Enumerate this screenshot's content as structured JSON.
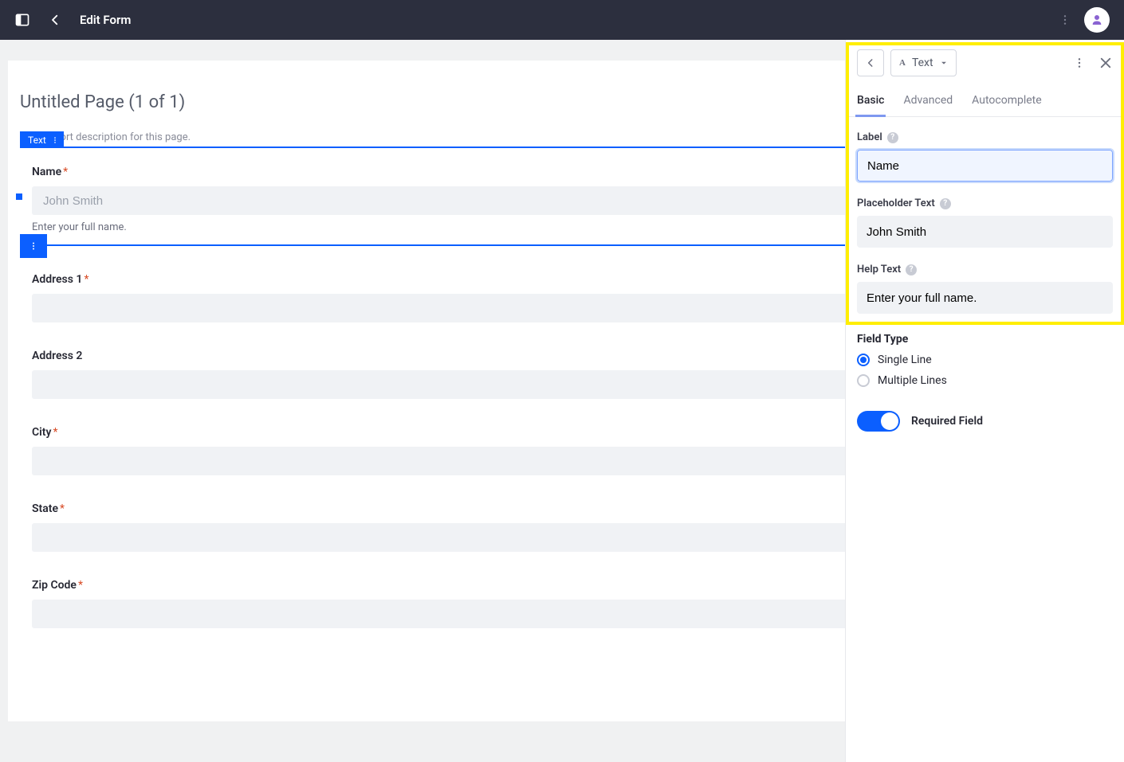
{
  "topbar": {
    "title": "Edit Form"
  },
  "page": {
    "title": "Untitled Page (1 of 1)",
    "desc": "Add a short description for this page."
  },
  "selected_field": {
    "tag": "Text",
    "label": "Name",
    "placeholder": "John Smith",
    "help": "Enter your full name."
  },
  "fields": [
    {
      "label": "Address 1",
      "required": true
    },
    {
      "label": "Address 2",
      "required": false
    },
    {
      "label": "City",
      "required": true
    },
    {
      "label": "State",
      "required": true
    },
    {
      "label": "Zip Code",
      "required": true
    }
  ],
  "panel": {
    "type_dropdown": "Text",
    "tabs": [
      "Basic",
      "Advanced",
      "Autocomplete"
    ],
    "active_tab": 0,
    "label_field": {
      "title": "Label",
      "value": "Name"
    },
    "placeholder_field": {
      "title": "Placeholder Text",
      "value": "John Smith"
    },
    "help_field": {
      "title": "Help Text",
      "value": "Enter your full name."
    },
    "field_type": {
      "title": "Field Type",
      "options": [
        "Single Line",
        "Multiple Lines"
      ],
      "selected": 0
    },
    "required_toggle": {
      "label": "Required Field",
      "on": true
    }
  }
}
